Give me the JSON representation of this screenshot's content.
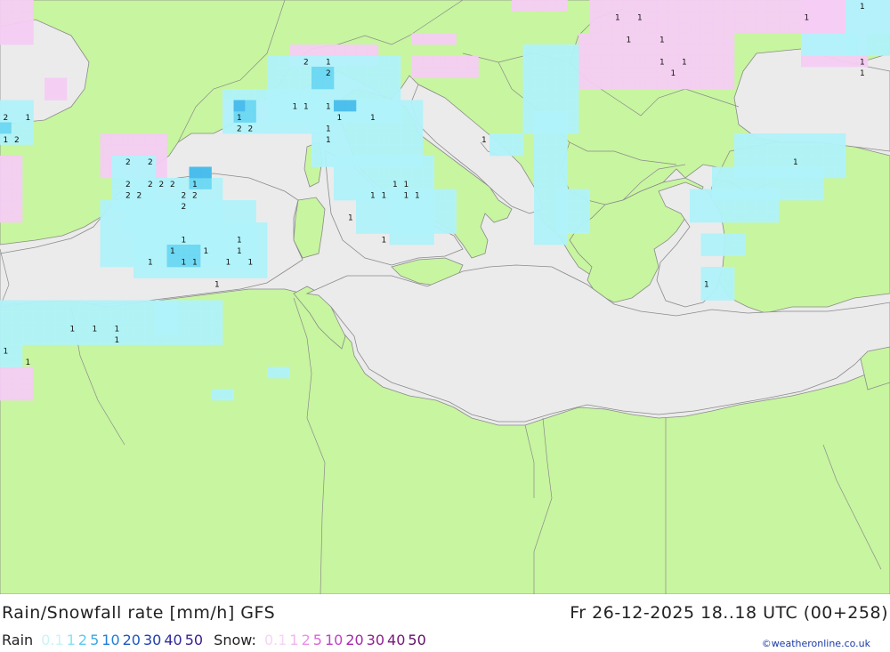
{
  "header": {
    "title": "Rain/Snowfall rate [mm/h] GFS",
    "time": "Fr 26-12-2025 18..18 UTC (00+258)"
  },
  "legend": {
    "rain_label": "Rain",
    "rain_values": [
      {
        "text": "0.1",
        "color": "#c8f4f8"
      },
      {
        "text": "1",
        "color": "#84e4f4"
      },
      {
        "text": "2",
        "color": "#5ccaf0"
      },
      {
        "text": "5",
        "color": "#3aa8e6"
      },
      {
        "text": "10",
        "color": "#1f7fd8"
      },
      {
        "text": "20",
        "color": "#1b58c2"
      },
      {
        "text": "30",
        "color": "#1e3ea8"
      },
      {
        "text": "40",
        "color": "#332a98"
      },
      {
        "text": "50",
        "color": "#3a1f8a"
      }
    ],
    "snow_label": "Snow:",
    "snow_values": [
      {
        "text": "0.1",
        "color": "#f7d4f4"
      },
      {
        "text": "1",
        "color": "#f2b4ee"
      },
      {
        "text": "2",
        "color": "#ec8fe6"
      },
      {
        "text": "5",
        "color": "#d865d8"
      },
      {
        "text": "10",
        "color": "#c043c4"
      },
      {
        "text": "20",
        "color": "#a52aa8"
      },
      {
        "text": "30",
        "color": "#8e1f90"
      },
      {
        "text": "40",
        "color": "#76187a"
      },
      {
        "text": "50",
        "color": "#601266"
      }
    ]
  },
  "credit": "©weatheronline.co.uk",
  "colors": {
    "land": "#c8f5a0",
    "sea": "#ebebeb",
    "rain_light": "#b0f2fa",
    "rain_mid": "#6cd6f2",
    "rain_heavy": "#48bcec",
    "snow_light": "#f6ccf4",
    "border": "#888888"
  },
  "cell_labels": [
    "1",
    "2"
  ]
}
